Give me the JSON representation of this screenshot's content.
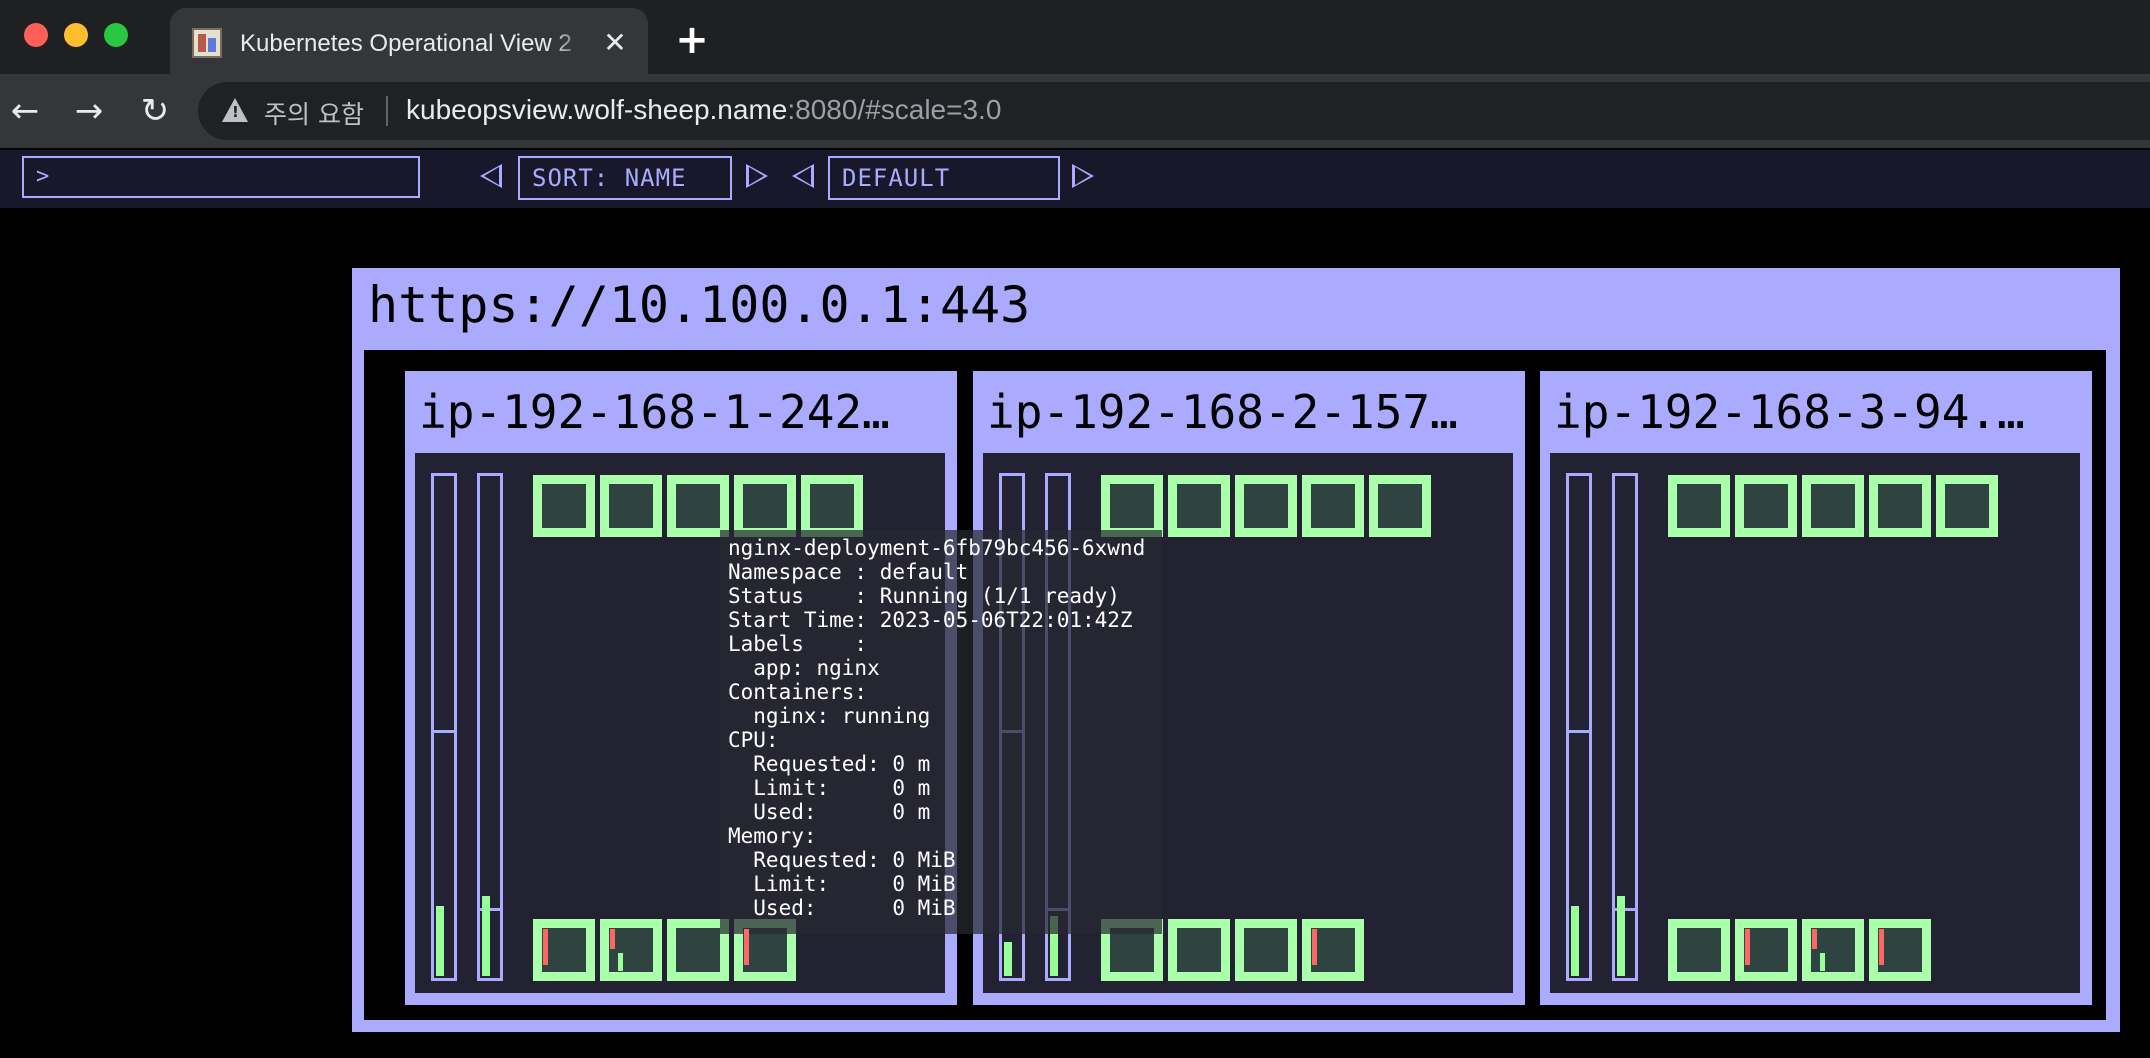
{
  "browser": {
    "tab_title": "Kubernetes Operational View 2",
    "tab_close": "✕",
    "new_tab": "+",
    "warning": "주의 요함",
    "url_host": "kubeopsview.wolf-sheep.name",
    "url_rest": ":8080/#scale=3.0"
  },
  "app": {
    "filter_prompt": ">",
    "sort_label": "SORT: NAME",
    "theme_label": "DEFAULT",
    "cluster_title": "https://10.100.0.1:443",
    "nodes": [
      {
        "name": "ip-192-168-1-242…"
      },
      {
        "name": "ip-192-168-2-157…"
      },
      {
        "name": "ip-192-168-3-94.…"
      }
    ]
  },
  "tooltip": {
    "pod_name": "nginx-deployment-6fb79bc456-6xwnd",
    "namespace_line": "Namespace : default",
    "status_line": "Status    : Running (1/1 ready)",
    "start_line": "Start Time: 2023-05-06T22:01:42Z",
    "labels_line": "Labels    :",
    "label_app": "  app: nginx",
    "containers_line": "Containers:",
    "container_status": "  nginx: running",
    "cpu_line": "CPU:",
    "cpu_requested": "  Requested: 0 m",
    "cpu_limit": "  Limit:     0 m",
    "cpu_used": "  Used:      0 m",
    "memory_line": "Memory:",
    "mem_requested": "  Requested: 0 MiB",
    "mem_limit": "  Limit:     0 MiB",
    "mem_used": "  Used:      0 MiB"
  },
  "colors": {
    "accent": "#aaaaff",
    "pod_running": "#aaffaa",
    "usage": "#99ff99",
    "usage_cpu_marker": "#ff6666"
  }
}
